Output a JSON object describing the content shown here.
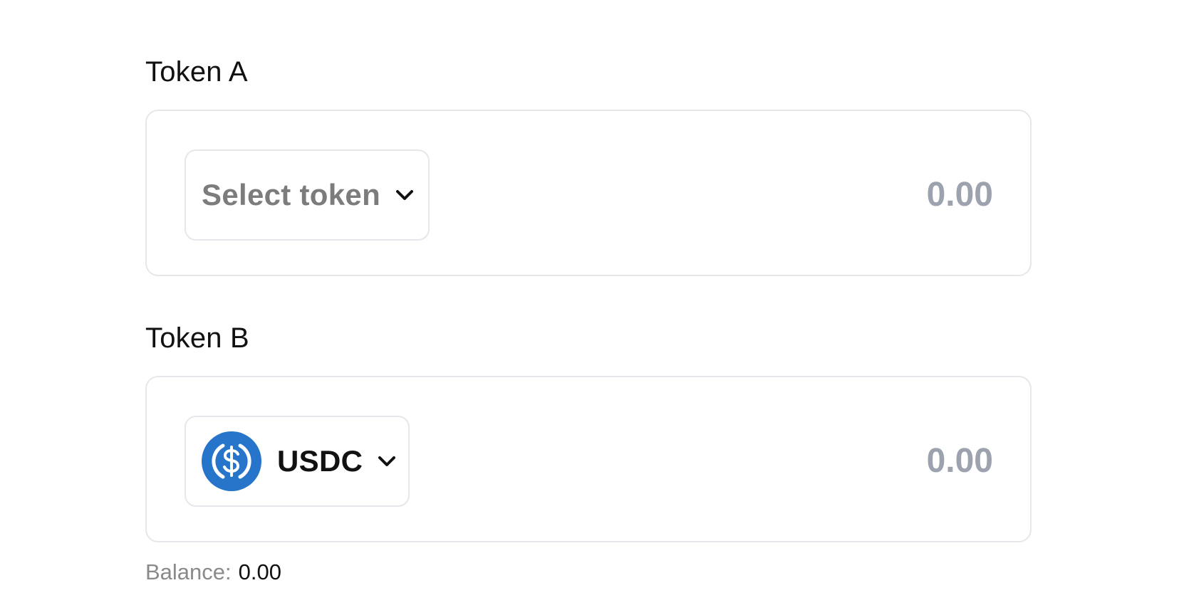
{
  "token_a": {
    "label": "Token A",
    "selector": {
      "text": "Select token",
      "icon": "chevron-down-icon"
    },
    "amount_placeholder": "0.00"
  },
  "token_b": {
    "label": "Token B",
    "selector": {
      "token_symbol": "USDC",
      "token_icon": "usdc-icon",
      "icon": "chevron-down-icon"
    },
    "amount_placeholder": "0.00",
    "balance": {
      "label": "Balance:",
      "value": "0.00"
    }
  },
  "colors": {
    "border": "#e5e7eb",
    "placeholder": "#9ca3af",
    "muted_text": "#7c7c7c",
    "usdc_blue": "#2775ca"
  }
}
